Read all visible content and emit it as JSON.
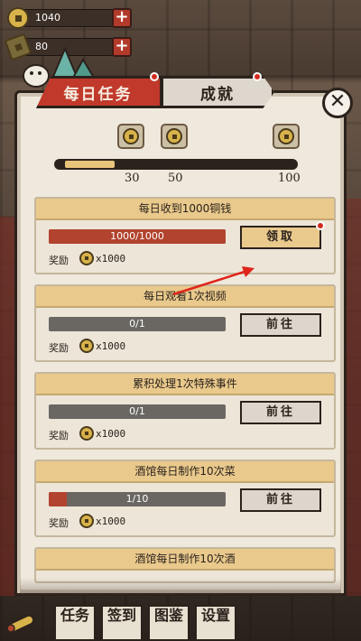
{
  "resources": {
    "coins": {
      "value": "1040",
      "icon": "copper-coin-icon"
    },
    "energy": {
      "value": "80",
      "icon": "axe-icon"
    }
  },
  "tabs": [
    {
      "label": "每日任务",
      "active": true,
      "has_dot": true
    },
    {
      "label": "成就",
      "active": false,
      "has_dot": true
    }
  ],
  "milestones": {
    "labels": [
      "30",
      "50",
      "100"
    ],
    "progress_fraction": 0.22
  },
  "tasks": [
    {
      "title": "每日收到1000铜钱",
      "progress_text": "1000/1000",
      "progress_fraction": 1.0,
      "reward_label": "奖励",
      "reward_value": "x1000",
      "button_label": "领取",
      "button_type": "claim",
      "has_dot": true
    },
    {
      "title": "每日观看1次视频",
      "progress_text": "0/1",
      "progress_fraction": 0.0,
      "reward_label": "奖励",
      "reward_value": "x1000",
      "button_label": "前往",
      "button_type": "go",
      "has_dot": false
    },
    {
      "title": "累积处理1次特殊事件",
      "progress_text": "0/1",
      "progress_fraction": 0.0,
      "reward_label": "奖励",
      "reward_value": "x1000",
      "button_label": "前往",
      "button_type": "go",
      "has_dot": false
    },
    {
      "title": "酒馆每日制作10次菜",
      "progress_text": "1/10",
      "progress_fraction": 0.1,
      "reward_label": "奖励",
      "reward_value": "x1000",
      "button_label": "前往",
      "button_type": "go",
      "has_dot": false
    },
    {
      "title": "酒馆每日制作10次酒",
      "progress_text": "",
      "progress_fraction": 0.0,
      "reward_label": "",
      "reward_value": "",
      "button_label": "",
      "button_type": "go",
      "has_dot": false
    }
  ],
  "bottom_nav": [
    {
      "label": "任务"
    },
    {
      "label": "签到"
    },
    {
      "label": "图鉴"
    },
    {
      "label": "设置"
    }
  ],
  "colors": {
    "accent_red": "#c0392b",
    "gold": "#e9c98c",
    "panel": "#efe8dc",
    "ink": "#2b221c"
  }
}
